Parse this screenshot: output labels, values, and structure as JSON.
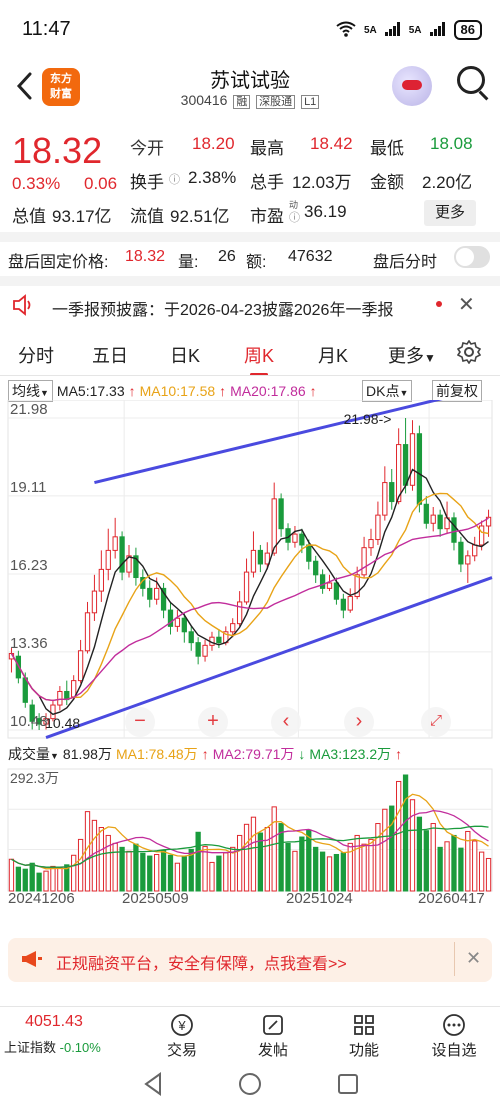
{
  "status_bar": {
    "time": "11:47",
    "network": "5A",
    "network2": "5A",
    "battery": "86"
  },
  "header": {
    "logo_line1": "东方",
    "logo_line2": "财富",
    "title": "苏试试验",
    "code": "300416",
    "tags": [
      "融",
      "深股通",
      "L1"
    ]
  },
  "quote": {
    "price": "18.32",
    "pct": "0.33%",
    "change": "0.06",
    "open_label": "今开",
    "open": "18.20",
    "high_label": "最高",
    "high": "18.42",
    "low_label": "最低",
    "low": "18.08",
    "turnover_label": "换手",
    "turnover": "2.38%",
    "volume_label": "总手",
    "volume": "12.03万",
    "amount_label": "金额",
    "amount": "2.20亿",
    "mktcap_label": "总值",
    "mktcap": "93.17亿",
    "float_label": "流值",
    "float": "92.51亿",
    "pe_label": "市盈",
    "pe_sup": "动",
    "pe": "36.19",
    "more": "更多"
  },
  "after_hours": {
    "label": "盘后固定价格:",
    "price": "18.32",
    "vol_label": "量:",
    "vol": "26",
    "amt_label": "额:",
    "amt": "47632",
    "toggle_label": "盘后分时"
  },
  "notice": {
    "text": "一季报预披露：于2026-04-23披露2026年一季报"
  },
  "tabs": [
    "分时",
    "五日",
    "日K",
    "周K",
    "月K",
    "更多"
  ],
  "active_tab": "周K",
  "kline": {
    "indicator": "均线",
    "ma5": "MA5:17.33",
    "ma10": "MA10:17.58",
    "ma20": "MA20:17.86",
    "dk": "DK点",
    "adjust": "前复权",
    "y_labels": [
      "21.98",
      "19.11",
      "16.23",
      "13.36",
      "10.48"
    ],
    "max_label": "21.98->",
    "min_label": "10.48",
    "colors": {
      "ma5": "#222222",
      "ma10": "#e8a317",
      "ma20": "#c12d9c",
      "up": "#e0272d",
      "down": "#1a9b3c",
      "trend": "#4a4adf"
    }
  },
  "volume": {
    "label": "成交量",
    "value": "81.98万",
    "ma1": "MA1:78.48万",
    "ma2": "MA2:79.71万",
    "ma3": "MA3:123.2万",
    "max": "292.3万",
    "dates": [
      "20241206",
      "20250509",
      "20251024",
      "20260417"
    ]
  },
  "chart_data": {
    "type": "candlestick",
    "title": "",
    "y_range": [
      10.48,
      21.98
    ],
    "y_ticks": [
      21.98,
      19.11,
      16.23,
      13.36,
      10.48
    ],
    "x_ticks": [
      "20241206",
      "20250509",
      "20251024",
      "20260417"
    ],
    "candles": [
      [
        13.1,
        13.3,
        12.6,
        13.5
      ],
      [
        13.2,
        12.4,
        12.2,
        13.4
      ],
      [
        12.4,
        11.5,
        11.3,
        12.6
      ],
      [
        11.4,
        10.8,
        10.5,
        11.6
      ],
      [
        10.9,
        10.7,
        10.48,
        11.1
      ],
      [
        10.7,
        10.9,
        10.5,
        11.1
      ],
      [
        10.9,
        11.4,
        10.8,
        11.6
      ],
      [
        11.4,
        11.9,
        11.2,
        12.1
      ],
      [
        11.9,
        11.6,
        11.4,
        12.3
      ],
      [
        11.7,
        12.3,
        11.6,
        12.5
      ],
      [
        12.3,
        13.4,
        12.2,
        13.8
      ],
      [
        13.4,
        14.8,
        13.3,
        15.2
      ],
      [
        14.8,
        15.6,
        14.5,
        16.2
      ],
      [
        15.6,
        16.4,
        15.2,
        17.1
      ],
      [
        16.4,
        17.1,
        16.0,
        17.9
      ],
      [
        17.1,
        17.6,
        16.8,
        18.3
      ],
      [
        17.6,
        16.3,
        16.0,
        17.8
      ],
      [
        16.3,
        16.9,
        16.1,
        17.3
      ],
      [
        16.9,
        16.1,
        15.8,
        17.2
      ],
      [
        16.1,
        15.7,
        15.4,
        16.4
      ],
      [
        15.7,
        15.3,
        15.0,
        16.0
      ],
      [
        15.3,
        15.7,
        15.1,
        16.1
      ],
      [
        15.7,
        14.9,
        14.6,
        15.9
      ],
      [
        14.9,
        14.3,
        14.0,
        15.2
      ],
      [
        14.3,
        14.6,
        14.1,
        14.9
      ],
      [
        14.6,
        14.1,
        13.7,
        14.8
      ],
      [
        14.1,
        13.7,
        13.4,
        14.3
      ],
      [
        13.7,
        13.2,
        12.9,
        13.9
      ],
      [
        13.2,
        13.6,
        13.0,
        13.8
      ],
      [
        13.6,
        13.9,
        13.4,
        14.1
      ],
      [
        13.9,
        13.7,
        13.5,
        14.2
      ],
      [
        13.7,
        14.1,
        13.6,
        14.3
      ],
      [
        14.1,
        14.4,
        13.9,
        14.6
      ],
      [
        14.4,
        15.2,
        14.3,
        15.6
      ],
      [
        15.2,
        16.3,
        15.1,
        16.8
      ],
      [
        16.3,
        17.1,
        16.1,
        17.8
      ],
      [
        17.1,
        16.6,
        16.3,
        17.3
      ],
      [
        16.6,
        17.0,
        16.4,
        17.4
      ],
      [
        17.0,
        19.0,
        16.9,
        19.6
      ],
      [
        19.0,
        17.9,
        17.6,
        19.2
      ],
      [
        17.9,
        17.4,
        17.1,
        18.1
      ],
      [
        17.4,
        17.7,
        17.2,
        18.0
      ],
      [
        17.7,
        17.3,
        17.0,
        17.9
      ],
      [
        17.3,
        16.7,
        16.4,
        17.5
      ],
      [
        16.7,
        16.2,
        15.9,
        16.9
      ],
      [
        16.2,
        15.7,
        15.5,
        16.4
      ],
      [
        15.7,
        15.9,
        15.6,
        16.2
      ],
      [
        15.9,
        15.3,
        15.1,
        16.1
      ],
      [
        15.3,
        14.9,
        14.6,
        15.5
      ],
      [
        14.9,
        15.4,
        14.8,
        15.7
      ],
      [
        15.4,
        16.2,
        15.3,
        16.5
      ],
      [
        16.2,
        17.2,
        16.1,
        17.6
      ],
      [
        17.2,
        17.5,
        16.9,
        17.9
      ],
      [
        17.5,
        18.4,
        17.3,
        18.9
      ],
      [
        18.4,
        19.6,
        18.2,
        20.2
      ],
      [
        19.6,
        18.9,
        18.6,
        20.1
      ],
      [
        18.9,
        21.0,
        18.8,
        21.6
      ],
      [
        21.0,
        19.5,
        19.2,
        21.98
      ],
      [
        19.5,
        21.4,
        19.3,
        21.9
      ],
      [
        21.4,
        18.8,
        18.5,
        21.7
      ],
      [
        18.8,
        18.1,
        17.9,
        19.1
      ],
      [
        18.1,
        18.4,
        17.8,
        18.7
      ],
      [
        18.4,
        17.9,
        17.6,
        18.6
      ],
      [
        17.9,
        18.3,
        17.7,
        18.9
      ],
      [
        18.3,
        17.4,
        17.1,
        18.5
      ],
      [
        17.4,
        16.6,
        16.3,
        17.6
      ],
      [
        16.6,
        16.9,
        15.9,
        17.1
      ],
      [
        16.9,
        17.3,
        16.7,
        17.6
      ],
      [
        17.3,
        18.0,
        17.1,
        18.2
      ],
      [
        18.0,
        18.32,
        17.6,
        18.6
      ]
    ],
    "volumes": [
      80,
      60,
      55,
      70,
      45,
      50,
      62,
      58,
      66,
      90,
      130,
      200,
      178,
      160,
      140,
      120,
      110,
      100,
      118,
      95,
      88,
      92,
      102,
      90,
      70,
      86,
      105,
      148,
      112,
      72,
      88,
      96,
      110,
      140,
      168,
      186,
      146,
      160,
      212,
      170,
      120,
      100,
      136,
      154,
      110,
      98,
      86,
      92,
      96,
      120,
      140,
      118,
      130,
      170,
      206,
      214,
      276,
      292.3,
      230,
      186,
      152,
      170,
      110,
      124,
      140,
      108,
      150,
      126,
      98,
      81.98
    ],
    "annotations": [
      "21.98->",
      "10.48"
    ]
  },
  "promo": {
    "text": "正规融资平台，安全有保障，点我查看>>"
  },
  "bottom_nav": {
    "index_value": "4051.43",
    "index_name": "上证指数",
    "index_change": "-0.10%",
    "items": [
      "交易",
      "发帖",
      "功能",
      "设自选"
    ]
  }
}
